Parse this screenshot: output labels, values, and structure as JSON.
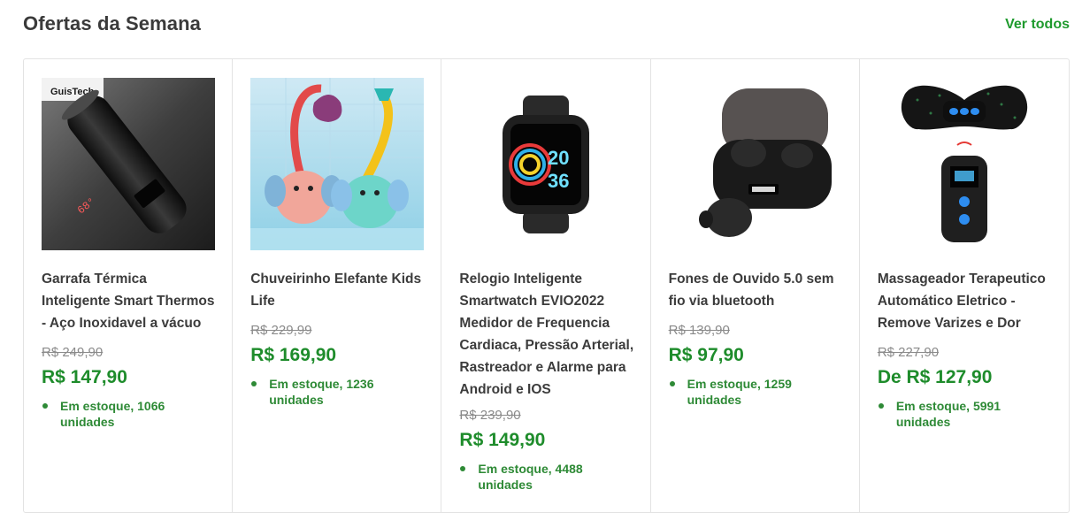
{
  "section": {
    "title": "Ofertas da Semana",
    "see_all_label": "Ver todos"
  },
  "products": [
    {
      "image_icon": "thermos-bottle-image",
      "image_brand_text": "GuisTech",
      "image_display_text": "68°",
      "title": "Garrafa Térmica Inteligente Smart Thermos - Aço Inoxidavel a vácuo",
      "old_price": "R$ 249,90",
      "price": "R$ 147,90",
      "stock": "Em estoque, 1066 unidades"
    },
    {
      "image_icon": "elephant-bath-toy-image",
      "title": "Chuveirinho Elefante Kids Life",
      "old_price": "R$ 229,99",
      "price": "R$ 169,90",
      "stock": "Em estoque, 1236 unidades"
    },
    {
      "image_icon": "smartwatch-image",
      "image_display_text": [
        "20",
        "36"
      ],
      "title": "Relogio Inteligente Smartwatch EVIO2022 Medidor de Frequencia Cardiaca, Pressão Arterial, Rastreador e Alarme para Android e IOS",
      "old_price": "R$ 239,90",
      "price": "R$ 149,90",
      "stock": "Em estoque, 4488 unidades"
    },
    {
      "image_icon": "wireless-earbuds-image",
      "title": "Fones de Ouvido 5.0 sem fio via bluetooth",
      "old_price": "R$ 139,90",
      "price": "R$ 97,90",
      "stock": "Em estoque, 1259 unidades"
    },
    {
      "image_icon": "massager-device-image",
      "title": "Massageador Terapeutico Automático Eletrico - Remove Varizes e Dor",
      "old_price": "R$ 227,90",
      "price": "De R$ 127,90",
      "stock": "Em estoque, 5991 unidades"
    }
  ]
}
